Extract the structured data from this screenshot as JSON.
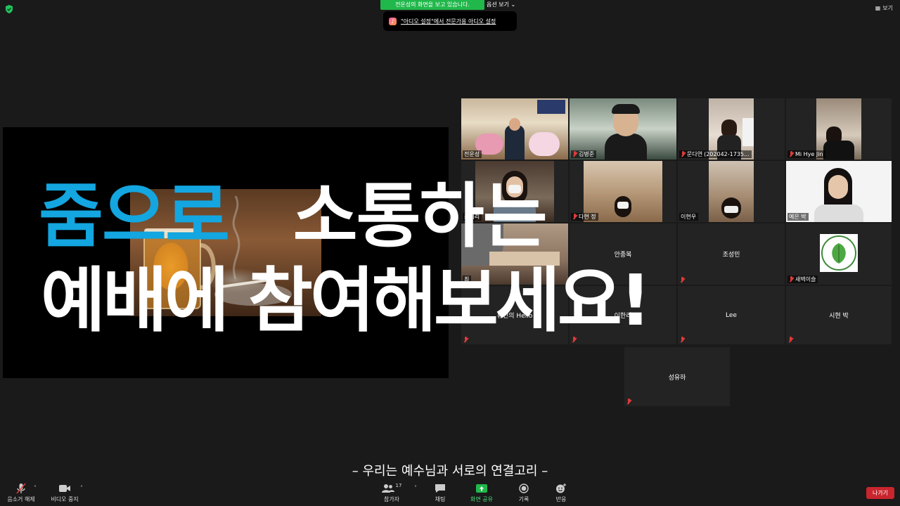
{
  "top": {
    "share_banner": "전운성의 화면을 보고 있습니다.",
    "view_options": "옵션 보기",
    "view_mode": "보기",
    "audio_tip": "\"아디오 설정\"에서 전문가용 아디오 설정"
  },
  "overlay": {
    "headline_blue": "줌으로",
    "headline_white": "소통하는",
    "headline_line2": "예배에 참여해보세요!",
    "footer": "– 우리는 예수님과 서로의 연결고리 –"
  },
  "participants": {
    "p1": "전운성",
    "p2": "김병준",
    "p3": "문다연",
    "p3_extra": "(202042-1735...",
    "p4": "Mi Hye Jin",
    "p5": "최미리",
    "p6": "다현 정",
    "p7": "이현우",
    "p8": "예은 박",
    "p9": "최",
    "p10": "안종복",
    "p11": "조성민",
    "p12": "새벽이슬",
    "p13": "유민의 Hello",
    "p14": "이한리",
    "p15": "Lee",
    "p16": "시현 박",
    "p17": "성유하"
  },
  "toolbar": {
    "unmute": "음소거 해제",
    "video": "비디오 중지",
    "participants": "참가자",
    "participants_count": "17",
    "chat": "채팅",
    "share": "화면 공유",
    "record": "기록",
    "reactions": "반응",
    "leave": "나가기"
  },
  "colors": {
    "accent_blue": "#13a6e0",
    "share_green": "#21b84b",
    "active_speaker": "#d8e63a",
    "leave_red": "#c9252e"
  }
}
